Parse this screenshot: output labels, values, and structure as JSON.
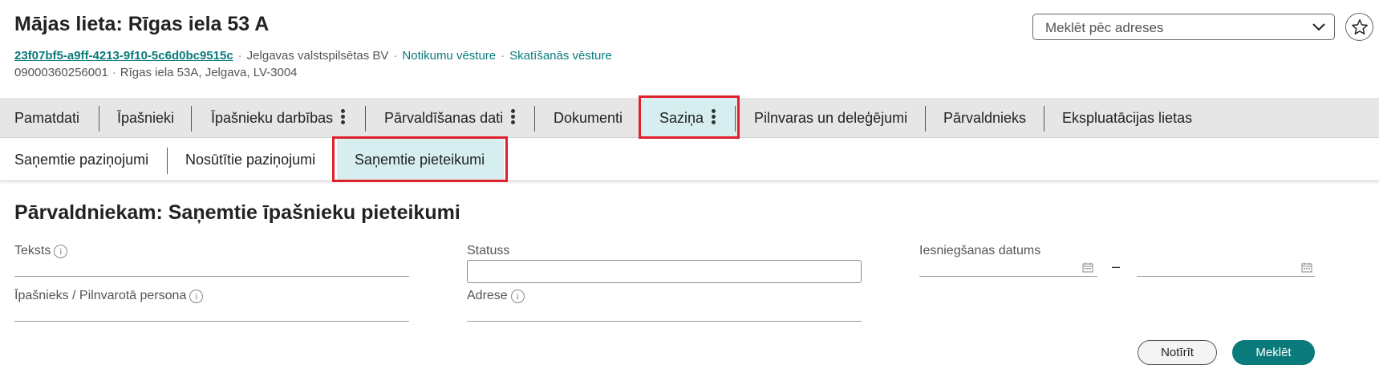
{
  "header": {
    "title": "Mājas lieta: Rīgas iela 53 A",
    "uuid": "23f07bf5-a9ff-4213-9f10-5c6d0bc9515c",
    "municipality": "Jelgavas valstspilsētas BV",
    "event_history_link": "Notikumu vēsture",
    "view_history_link": "Skatīšanās vēsture",
    "cadastre_number": "09000360256001",
    "address": "Rīgas iela 53A, Jelgava, LV-3004",
    "separator": "·"
  },
  "address_search": {
    "placeholder": "Meklēt pēc adreses",
    "icon": "chevron-down-icon"
  },
  "favorite_icon": "star-icon",
  "main_tabs": [
    {
      "label": "Pamatdati",
      "has_menu": false
    },
    {
      "label": "Īpašnieki",
      "has_menu": false
    },
    {
      "label": "Īpašnieku darbības",
      "has_menu": true
    },
    {
      "label": "Pārvaldīšanas dati",
      "has_menu": true
    },
    {
      "label": "Dokumenti",
      "has_menu": false
    },
    {
      "label": "Saziņa",
      "has_menu": true,
      "active": true
    },
    {
      "label": "Pilnvaras un deleģējumi",
      "has_menu": false
    },
    {
      "label": "Pārvaldnieks",
      "has_menu": false
    },
    {
      "label": "Ekspluatācijas lietas",
      "has_menu": false
    }
  ],
  "sub_tabs": [
    {
      "label": "Saņemtie paziņojumi"
    },
    {
      "label": "Nosūtītie paziņojumi"
    },
    {
      "label": "Saņemtie pieteikumi",
      "active": true
    }
  ],
  "section": {
    "title": "Pārvaldniekam: Saņemtie īpašnieku pieteikumi"
  },
  "filters": {
    "text_label": "Teksts",
    "status_label": "Statuss",
    "submit_date_label": "Iesniegšanas datums",
    "date_range_dash": "–",
    "owner_label": "Īpašnieks / Pilnvarotā persona",
    "address_label": "Adrese",
    "info_glyph": "i"
  },
  "buttons": {
    "clear": "Notīrīt",
    "search": "Meklēt"
  },
  "colors": {
    "accent": "#0a7a7a",
    "highlight": "#e0202a",
    "active_tab_bg": "#d6eef0",
    "tab_bar_bg": "#e6e6e6"
  }
}
